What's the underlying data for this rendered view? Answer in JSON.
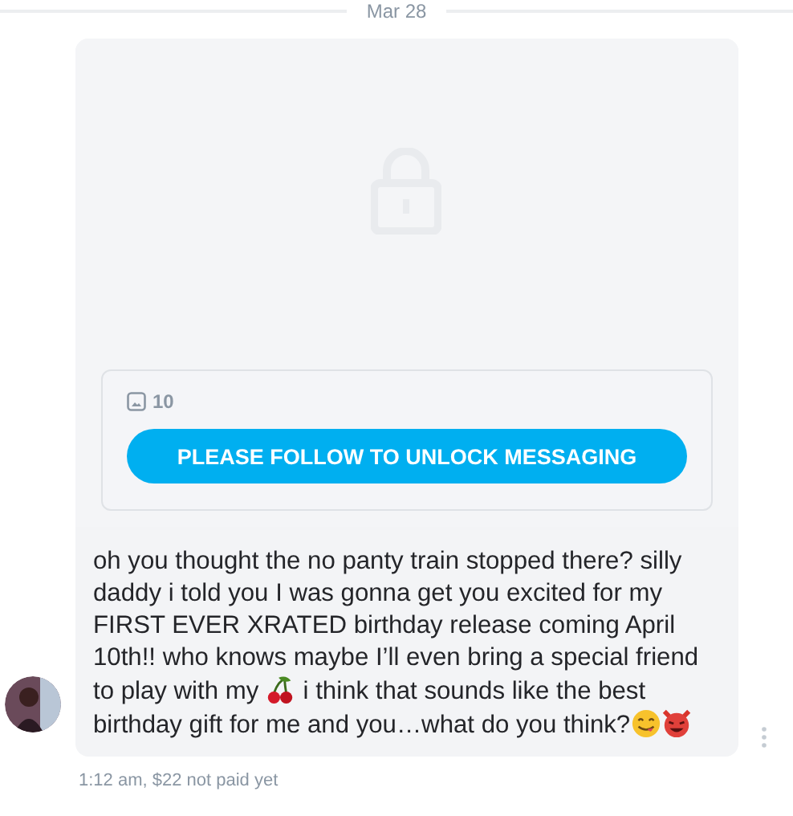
{
  "date_divider": "Mar 28",
  "locked_media": {
    "media_count": "10",
    "unlock_button": "PLEASE FOLLOW TO UNLOCK MESSAGING"
  },
  "message": {
    "segments": [
      {
        "kind": "text",
        "text": "oh you thought the no panty train stopped there? silly daddy i told you I was gonna get you excited for my FIRST EVER XRATED birthday release coming April 10th!! who knows maybe I’ll even bring a special friend to play with my "
      },
      {
        "kind": "cherry"
      },
      {
        "kind": "text",
        "text": " i think that sounds like the best birthday gift for me and you…what do you think?"
      },
      {
        "kind": "yum"
      },
      {
        "kind": "devil"
      }
    ]
  },
  "meta": "1:12 am,",
  "price": "$22 not paid yet"
}
